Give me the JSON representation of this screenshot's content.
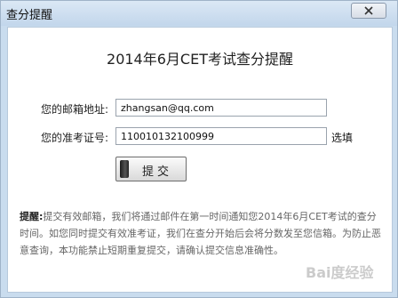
{
  "window": {
    "title": "查分提醒",
    "close_icon": "close-icon"
  },
  "dialog": {
    "heading": "2014年6月CET考试查分提醒",
    "email_label": "您的邮箱地址:",
    "email_value": "zhangsan@qq.com",
    "exam_id_label": "您的准考证号:",
    "exam_id_value": "110010132100999",
    "select_link": "选填",
    "submit_label": "提交",
    "notice_head": "提醒:",
    "notice_body": "提交有效邮箱，我们将通过邮件在第一时间通知您2014年6月CET考试的查分时间。如您同时提交有效准考证，我们在查分开始后会将分数发至您信箱。为防止恶意查询，本功能禁止短期重复提交，请确认提交信息准确性。"
  },
  "watermark": {
    "text": "Bai度经验"
  },
  "colors": {
    "titlebar": "#c9dcee",
    "notice_text": "#666666"
  }
}
